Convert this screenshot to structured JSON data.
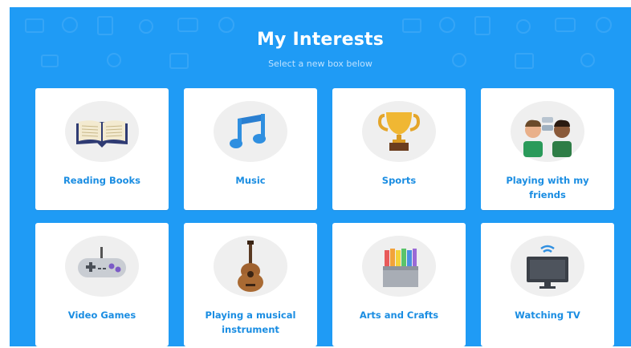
{
  "header": {
    "title": "My Interests",
    "subtitle": "Select a new box below"
  },
  "colors": {
    "background": "#1f9bf5",
    "label": "#1a8de2",
    "card": "#ffffff",
    "icon_circle": "#efefef"
  },
  "interests": [
    {
      "label": "Reading Books",
      "icon": "book-icon"
    },
    {
      "label": "Music",
      "icon": "music-note-icon"
    },
    {
      "label": "Sports",
      "icon": "trophy-icon"
    },
    {
      "label": "Playing with my friends",
      "icon": "friends-icon"
    },
    {
      "label": "Video Games",
      "icon": "game-controller-icon"
    },
    {
      "label": "Playing a musical instrument",
      "icon": "guitar-icon"
    },
    {
      "label": "Arts and Crafts",
      "icon": "crayons-icon"
    },
    {
      "label": "Watching TV",
      "icon": "tv-icon"
    }
  ]
}
